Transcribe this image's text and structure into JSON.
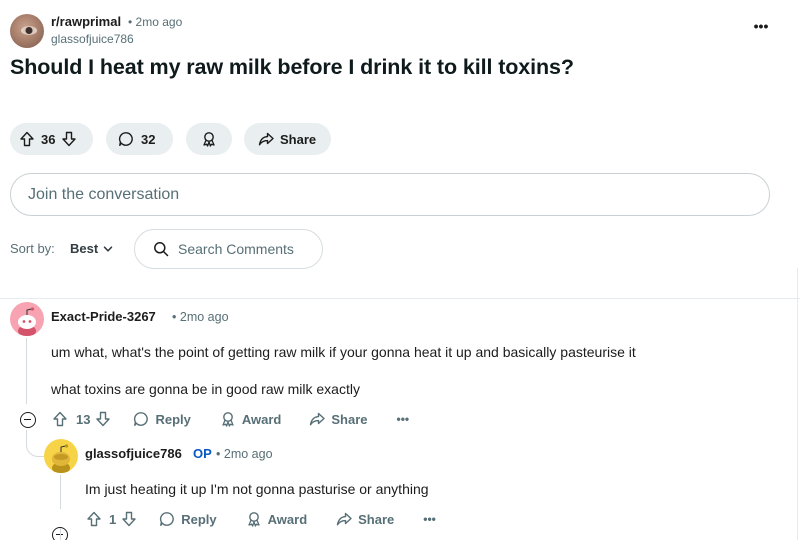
{
  "post": {
    "subreddit": "r/rawprimal",
    "separator": "•",
    "time": "2mo ago",
    "author": "glassofjuice786",
    "title": "Should I heat my raw milk before I drink it to kill toxins?",
    "more_label": "•••",
    "votes": "36",
    "comments": "32",
    "share_label": "Share"
  },
  "composer": {
    "placeholder": "Join the conversation"
  },
  "sort": {
    "label": "Sort by:",
    "value": "Best"
  },
  "search": {
    "placeholder": "Search Comments"
  },
  "comments": [
    {
      "author": "Exact-Pride-3267",
      "separator": "•",
      "time": "2mo ago",
      "body": [
        "um what, what's the point of getting raw milk if your gonna heat it up and basically pasteurise it",
        "what toxins are gonna be in good raw milk exactly"
      ],
      "votes": "13",
      "reply_label": "Reply",
      "award_label": "Award",
      "share_label": "Share",
      "more_label": "•••"
    },
    {
      "author": "glassofjuice786",
      "op_badge": "OP",
      "separator": "•",
      "time": "2mo ago",
      "body": [
        "Im just heating it up I'm not gonna pasturise or anything"
      ],
      "votes": "1",
      "reply_label": "Reply",
      "award_label": "Award",
      "share_label": "Share",
      "more_label": "•••"
    }
  ],
  "icons": {
    "upvote": "upvote-icon",
    "downvote": "downvote-icon",
    "comment": "comment-icon",
    "award": "award-icon",
    "share": "share-icon",
    "search": "search-icon",
    "chevron": "chevron-down-icon",
    "collapse": "collapse-icon"
  },
  "colors": {
    "op_badge": "#0a57c2",
    "pill_bg": "#e9eef0",
    "meta_text": "#576f76"
  }
}
